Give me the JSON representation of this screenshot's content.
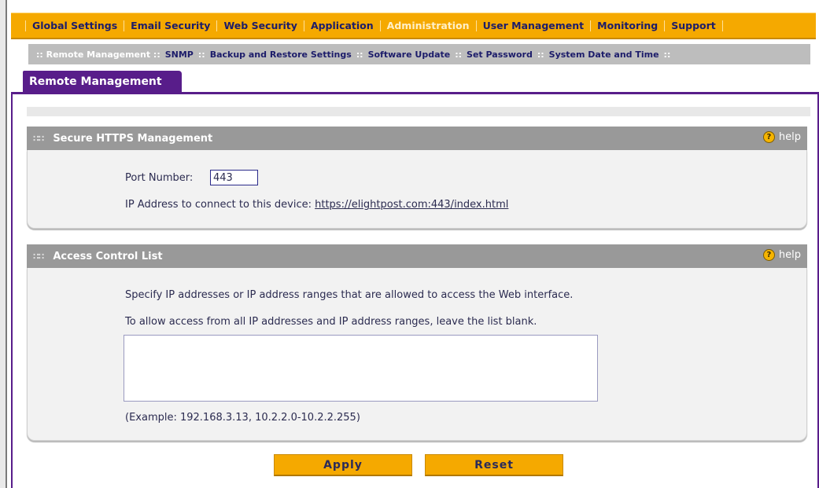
{
  "main_nav": {
    "items": [
      {
        "label": "Global Settings",
        "active": false
      },
      {
        "label": "Email Security",
        "active": false
      },
      {
        "label": "Web Security",
        "active": false
      },
      {
        "label": "Application",
        "active": false
      },
      {
        "label": "Administration",
        "active": true
      },
      {
        "label": "User Management",
        "active": false
      },
      {
        "label": "Monitoring",
        "active": false
      },
      {
        "label": "Support",
        "active": false
      }
    ]
  },
  "sub_nav": {
    "items": [
      {
        "label": ":: Remote Management ::",
        "active": true
      },
      {
        "label": "SNMP",
        "active": false
      },
      {
        "label": "Backup and Restore Settings",
        "active": false
      },
      {
        "label": "Software Update",
        "active": false
      },
      {
        "label": "Set Password",
        "active": false
      },
      {
        "label": "System Date and Time",
        "active": false
      }
    ],
    "separator": "::"
  },
  "tab": {
    "label": "Remote Management"
  },
  "https_section": {
    "title": "Secure HTTPS Management",
    "help_label": "help",
    "port_label": "Port Number:",
    "port_value": "443",
    "ip_label": "IP Address to connect to this device:",
    "ip_link": "https://elightpost.com:443/index.html"
  },
  "acl_section": {
    "title": "Access Control List",
    "help_label": "help",
    "instruction_1": "Specify IP addresses or IP address ranges that are allowed to access the Web interface.",
    "instruction_2": "To allow access from all IP addresses and IP address ranges, leave the list blank.",
    "list_value": "",
    "example": "(Example: 192.168.3.13, 10.2.2.0-10.2.2.255)"
  },
  "buttons": {
    "apply": "Apply",
    "reset": "Reset"
  },
  "colors": {
    "nav_orange": "#f5a900",
    "tab_purple": "#581d8a",
    "section_gray": "#999999"
  },
  "icons": {
    "help": "question-circle-icon",
    "grip": "grip-icon"
  }
}
